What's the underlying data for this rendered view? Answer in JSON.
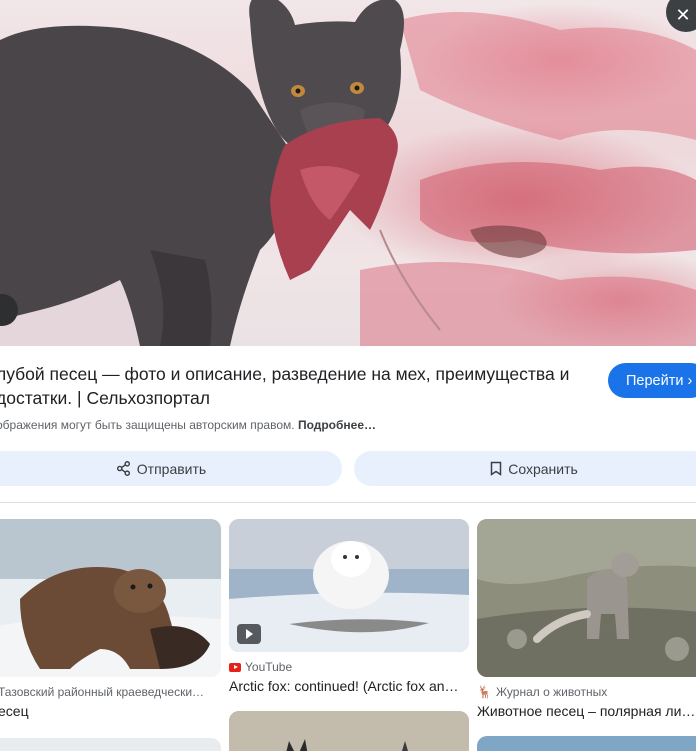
{
  "result": {
    "title": "лубой песец — фото и описание, разведение на мех, преимущества и\nдостатки. | Сельхозпортал",
    "visit_label": "Перейти",
    "copyright_text": "ображения могут быть защищены авторским правом.",
    "more_label": "Подробнее…",
    "share_label": "Отправить",
    "save_label": "Сохранить"
  },
  "related": [
    {
      "source": "Тазовский районный краеведчески…",
      "caption": "есец"
    },
    {
      "source": "YouTube",
      "caption": "Arctic fox: continued! (Arctic fox an…"
    },
    {
      "source": "Журнал о животных",
      "caption": "Животное песец – полярная ли…"
    }
  ],
  "colors": {
    "accent": "#1a73e8",
    "button_bg": "#e8f0fe",
    "youtube_red": "#e62117"
  }
}
